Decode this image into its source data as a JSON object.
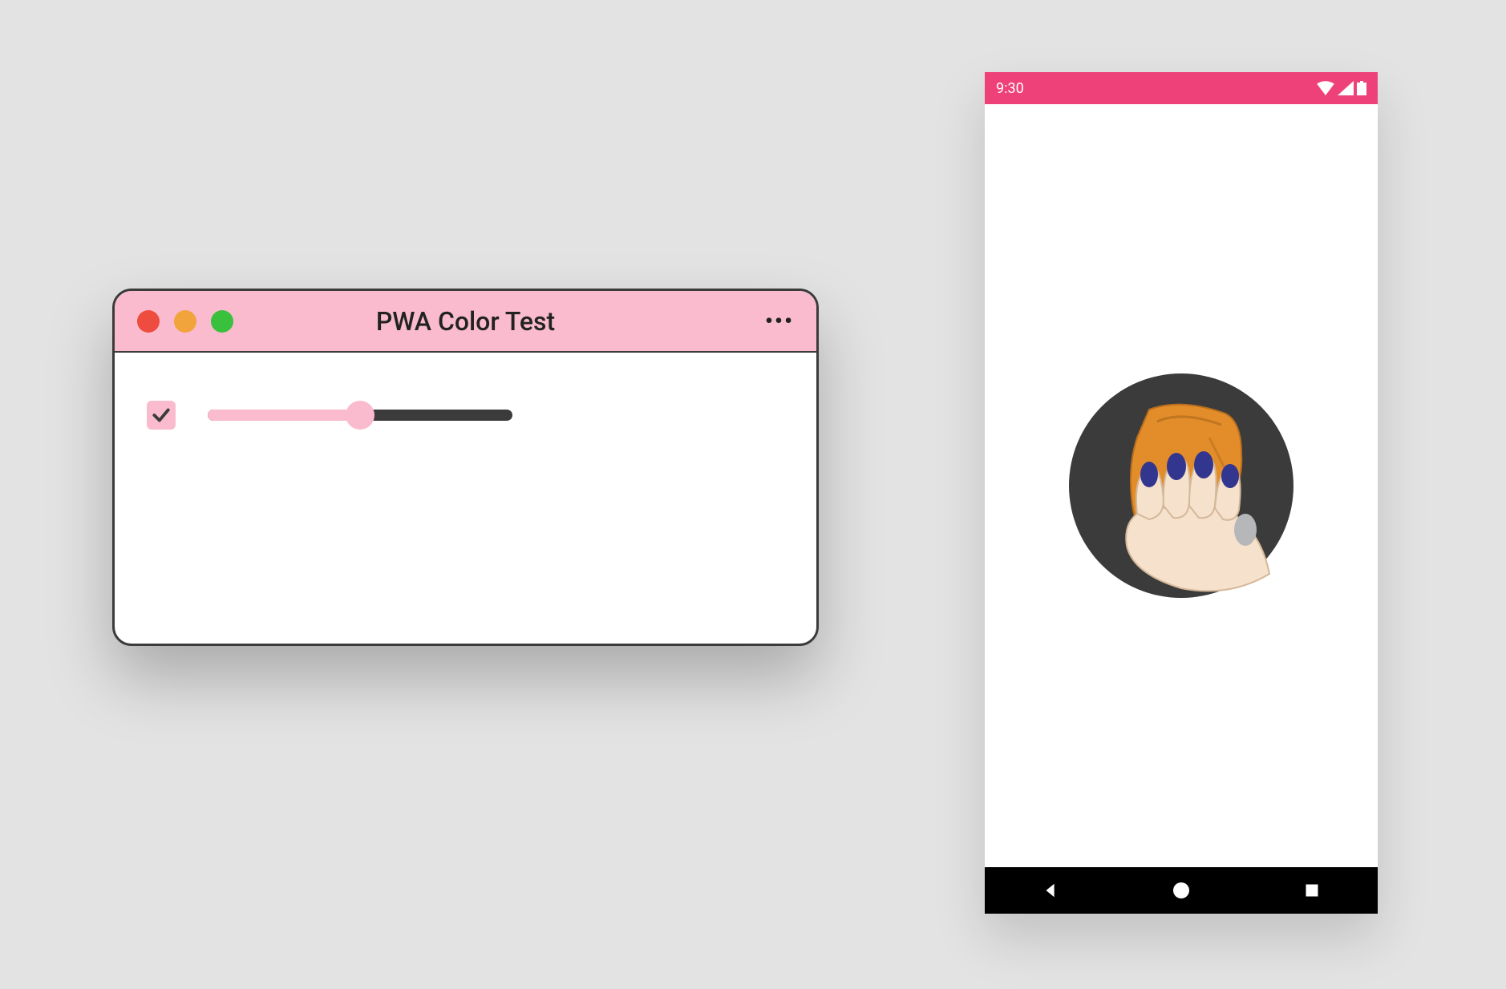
{
  "canvas": {
    "background": "#e3e3e3"
  },
  "desktop": {
    "title": "PWA Color Test",
    "menu_label": "•••",
    "titlebar_color": "#fabbce",
    "traffic_lights": {
      "close": "#ed4c3e",
      "minimize": "#f1a33c",
      "zoom": "#39c03c"
    },
    "accent_color": "#fabbce",
    "checkbox": {
      "checked": true,
      "check_color": "#3b3b3b",
      "bg_color": "#fabbce"
    },
    "slider": {
      "value": 50,
      "min": 0,
      "max": 100,
      "track_color": "#3b3b3b",
      "fill_color": "#fabbce",
      "thumb_color": "#fabbce"
    }
  },
  "phone": {
    "statusbar": {
      "time": "9:30",
      "bg_color": "#ee4179",
      "icons": {
        "wifi": "wifi-icon",
        "signal": "signal-icon",
        "battery": "battery-icon"
      }
    },
    "splash_bg": "#ffffff",
    "app_icon": {
      "name": "hand-crushing-can-icon",
      "circle_bg": "#3b3b3b",
      "can_color": "#e38d2a",
      "skin_color": "#f6e1cc",
      "nail_color": "#33368f"
    },
    "navbar": {
      "bg_color": "#000000",
      "icons": {
        "back": "back-icon",
        "home": "home-icon",
        "recents": "recents-icon"
      }
    }
  }
}
